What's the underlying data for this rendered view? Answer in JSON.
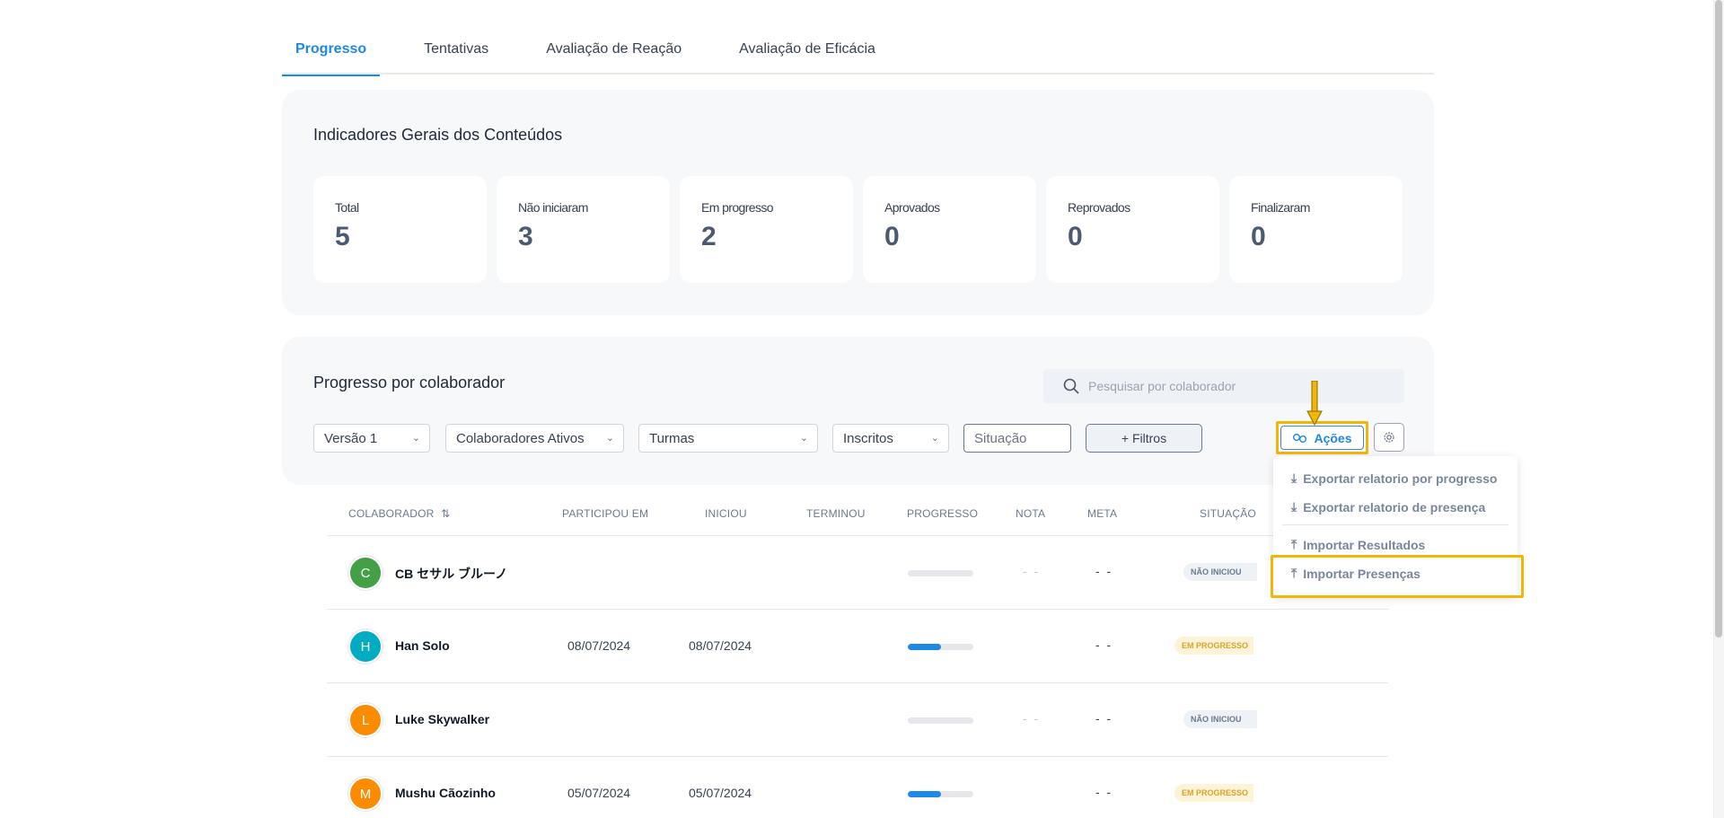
{
  "tabs": [
    {
      "label": "Progresso",
      "active": true
    },
    {
      "label": "Tentativas",
      "active": false
    },
    {
      "label": "Avaliação de Reação",
      "active": false
    },
    {
      "label": "Avaliação de Eficácia",
      "active": false
    }
  ],
  "indicators": {
    "title": "Indicadores Gerais dos Conteúdos",
    "cards": [
      {
        "label": "Total",
        "value": "5"
      },
      {
        "label": "Não iniciaram",
        "value": "3"
      },
      {
        "label": "Em progresso",
        "value": "2"
      },
      {
        "label": "Aprovados",
        "value": "0"
      },
      {
        "label": "Reprovados",
        "value": "0"
      },
      {
        "label": "Finalizaram",
        "value": "0"
      }
    ]
  },
  "progress": {
    "title": "Progresso por colaborador",
    "search_placeholder": "Pesquisar por colaborador",
    "filters": {
      "version": "Versão 1",
      "collaborators": "Colaboradores Ativos",
      "classes": "Turmas",
      "enrolled": "Inscritos",
      "situation_placeholder": "Situação",
      "more_filters": "+ Filtros"
    },
    "actions_label": "Ações",
    "actions_menu": [
      "Exportar relatorio por progresso",
      "Exportar relatorio de presença",
      "Importar Resultados",
      "Importar Presenças"
    ]
  },
  "table": {
    "columns": [
      "COLABORADOR",
      "PARTICIPOU EM",
      "INICIOU",
      "TERMINOU",
      "PROGRESSO",
      "NOTA",
      "META",
      "SITUAÇÃO"
    ],
    "rows": [
      {
        "initial": "C",
        "avatar_color": "#43a047",
        "name": "CB セサル ブルーノ",
        "participated": "",
        "started": "",
        "finished": "",
        "progress": 0,
        "grade": "- -",
        "goal": "- -",
        "status": "NÃO INICIOU"
      },
      {
        "initial": "H",
        "avatar_color": "#00acc1",
        "name": "Han Solo",
        "participated": "08/07/2024",
        "started": "08/07/2024",
        "finished": "",
        "progress": 0.5,
        "grade": "",
        "goal": "- -",
        "status": "EM PROGRESSO"
      },
      {
        "initial": "L",
        "avatar_color": "#fb8c00",
        "name": "Luke Skywalker",
        "participated": "",
        "started": "",
        "finished": "",
        "progress": 0,
        "grade": "- -",
        "goal": "- -",
        "status": "NÃO INICIOU"
      },
      {
        "initial": "M",
        "avatar_color": "#fb8c00",
        "name": "Mushu Cãozinho",
        "participated": "05/07/2024",
        "started": "05/07/2024",
        "finished": "",
        "progress": 0.5,
        "grade": "",
        "goal": "- -",
        "status": "EM PROGRESSO"
      }
    ]
  },
  "colors": {
    "accent": "#1e88e5",
    "highlight": "#f2b705"
  }
}
